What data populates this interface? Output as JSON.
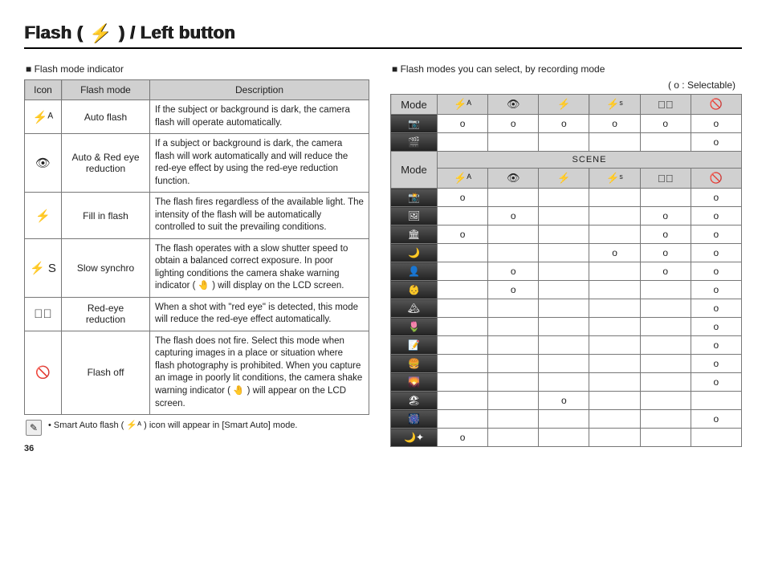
{
  "title_parts": [
    "Flash (",
    "⚡",
    ") / Left button"
  ],
  "left": {
    "heading": "Flash mode indicator",
    "headers": [
      "Icon",
      "Flash mode",
      "Description"
    ],
    "rows": [
      {
        "icon": "⚡ᴬ",
        "mode": "Auto flash",
        "desc": "If the subject or background is dark, the camera flash will operate automatically."
      },
      {
        "icon": "👁",
        "mode": "Auto & Red eye reduction",
        "desc": "If a subject or background is dark, the camera flash will work automatically and will reduce the red-eye effect by using the red-eye reduction function."
      },
      {
        "icon": "⚡",
        "mode": "Fill in flash",
        "desc": "The flash fires regardless of the available light. The intensity of the flash will be automatically controlled to suit the prevailing conditions."
      },
      {
        "icon": "⚡ S",
        "mode": "Slow synchro",
        "desc": "The flash operates with a slow shutter speed to obtain a balanced correct exposure. In poor lighting conditions the camera shake warning indicator ( 🤚 ) will display on the LCD screen."
      },
      {
        "icon": "👁⃠",
        "mode": "Red-eye reduction",
        "desc": "When a shot with \"red eye\" is detected, this mode will reduce the red-eye effect automatically."
      },
      {
        "icon": "🚫",
        "mode": "Flash off",
        "desc": "The flash does not fire.\nSelect this mode when capturing images in a place or situation where flash photography is prohibited. When you capture an image in poorly lit conditions, the camera shake warning indicator ( 🤚 ) will appear on the LCD screen."
      }
    ],
    "note_icon": "✎",
    "note_text": "• Smart Auto flash ( ⚡ᴬ ) icon will appear in [Smart Auto] mode."
  },
  "right": {
    "heading": "Flash modes you can select, by recording mode",
    "legend": "( o : Selectable)",
    "mode_header": "Mode",
    "col_icons": [
      "⚡ᴬ",
      "👁",
      "⚡",
      "⚡ˢ",
      "👁⃠",
      "🚫"
    ],
    "top_rows": [
      {
        "m": "📷",
        "cells": [
          "o",
          "o",
          "o",
          "o",
          "o",
          "o"
        ]
      },
      {
        "m": "🎬",
        "cells": [
          "",
          "",
          "",
          "",
          "",
          "o"
        ]
      }
    ],
    "scene_header": "SCENE",
    "scene_rows": [
      {
        "m": "📸",
        "cells": [
          "o",
          "",
          "",
          "",
          "",
          "o"
        ]
      },
      {
        "m": "🖼",
        "cells": [
          "",
          "o",
          "",
          "",
          "o",
          "o"
        ]
      },
      {
        "m": "🏛",
        "cells": [
          "o",
          "",
          "",
          "",
          "o",
          "o"
        ]
      },
      {
        "m": "🌙",
        "cells": [
          "",
          "",
          "",
          "o",
          "o",
          "o"
        ]
      },
      {
        "m": "👤",
        "cells": [
          "",
          "o",
          "",
          "",
          "o",
          "o"
        ]
      },
      {
        "m": "👶",
        "cells": [
          "",
          "o",
          "",
          "",
          "",
          "o"
        ]
      },
      {
        "m": "🏔",
        "cells": [
          "",
          "",
          "",
          "",
          "",
          "o"
        ]
      },
      {
        "m": "🌷",
        "cells": [
          "",
          "",
          "",
          "",
          "",
          "o"
        ]
      },
      {
        "m": "📝",
        "cells": [
          "",
          "",
          "",
          "",
          "",
          "o"
        ]
      },
      {
        "m": "🍔",
        "cells": [
          "",
          "",
          "",
          "",
          "",
          "o"
        ]
      },
      {
        "m": "🌄",
        "cells": [
          "",
          "",
          "",
          "",
          "",
          "o"
        ]
      },
      {
        "m": "🏖",
        "cells": [
          "",
          "",
          "o",
          "",
          "",
          ""
        ]
      },
      {
        "m": "🎆",
        "cells": [
          "",
          "",
          "",
          "",
          "",
          "o"
        ]
      },
      {
        "m": "🌙✦",
        "cells": [
          "o",
          "",
          "",
          "",
          "",
          ""
        ]
      }
    ]
  },
  "page_number": "36"
}
